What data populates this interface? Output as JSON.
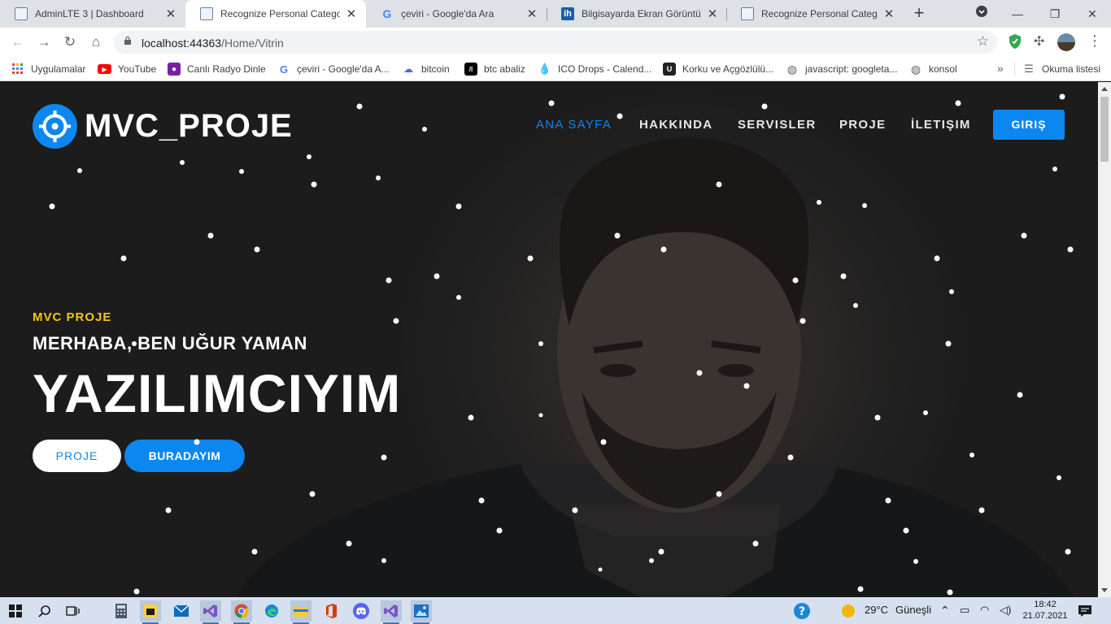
{
  "browser": {
    "tabs": [
      {
        "title": "AdminLTE 3 | Dashboard",
        "favicon": "document-icon",
        "active": false
      },
      {
        "title": "Recognize Personal Category",
        "favicon": "document-icon",
        "active": true
      },
      {
        "title": "çeviri - Google'da Ara",
        "favicon": "google-icon",
        "active": false
      },
      {
        "title": "Bilgisayarda Ekran Görüntüsü",
        "favicon": "ih-icon",
        "active": false
      },
      {
        "title": "Recognize Personal Category",
        "favicon": "document-icon",
        "active": false
      }
    ],
    "url_host": "localhost:44363",
    "url_path": "/Home/Vitrin",
    "bookmarks": [
      {
        "label": "Uygulamalar",
        "icon": "apps-grid-icon"
      },
      {
        "label": "YouTube",
        "icon": "youtube-icon"
      },
      {
        "label": "Canlı Radyo Dinle",
        "icon": "radio-icon"
      },
      {
        "label": "çeviri - Google'da A...",
        "icon": "google-icon"
      },
      {
        "label": "bitcoin",
        "icon": "bitcoin-icon"
      },
      {
        "label": "btc abaliz",
        "icon": "tradingview-icon"
      },
      {
        "label": "ICO Drops - Calend...",
        "icon": "drop-icon"
      },
      {
        "label": "Korku ve Açgözlülü...",
        "icon": "fear-greed-icon"
      },
      {
        "label": "javascript: googleta...",
        "icon": "globe-icon"
      },
      {
        "label": "konsol",
        "icon": "globe-icon"
      }
    ],
    "reading_list": "Okuma listesi"
  },
  "site": {
    "logo_text": "MVC_PROJE",
    "nav": [
      {
        "label": "ANA SAYFA",
        "active": true
      },
      {
        "label": "HAKKINDA",
        "active": false
      },
      {
        "label": "SERVISLER",
        "active": false
      },
      {
        "label": "PROJE",
        "active": false
      },
      {
        "label": "İLETIŞIM",
        "active": false
      }
    ],
    "login_label": "GIRIŞ",
    "hero": {
      "eyebrow": "MVC PROJE",
      "greeting": "MERHABA, BEN UĞUR YAMAN",
      "headline": "YAZILIMCIYIM",
      "btn_primary": "PROJE",
      "btn_secondary": "BURADAYIM"
    },
    "colors": {
      "accent": "#0d87f0",
      "eyebrow": "#f5c518"
    }
  },
  "taskbar": {
    "weather_temp": "29°C",
    "weather_text": "Güneşli",
    "time": "18:42",
    "date": "21.07.2021"
  }
}
